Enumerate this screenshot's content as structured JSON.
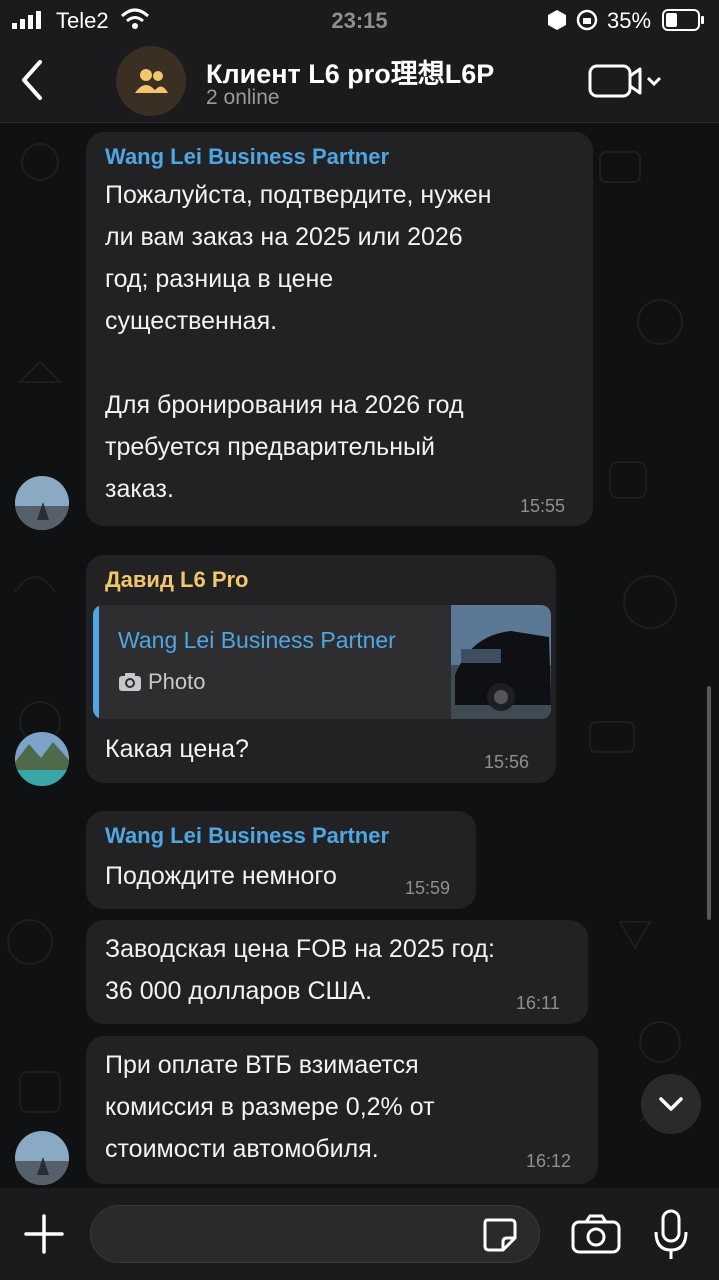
{
  "status_bar": {
    "carrier": "Tele2",
    "time": "23:15",
    "battery_percent": "35%",
    "battery_level": 0.35
  },
  "header": {
    "title": "Клиент L6 pro理想L6P",
    "subtitle": "2 online",
    "back_icon": "chevron-left-icon",
    "group_icon": "group-icon",
    "video_icon": "video-camera-icon"
  },
  "messages": [
    {
      "sender": "Wang Lei Business Partner",
      "sender_color": "#4ea6e3",
      "lines": [
        "Пожалуйста, подтвердите, нужен",
        "ли вам заказ на 2025 или 2026",
        "год; разница в цене",
        "существенная.",
        "",
        "Для бронирования на 2026 год",
        "требуется предварительный",
        "заказ."
      ],
      "time": "15:55"
    },
    {
      "sender": "Давид L6 Pro",
      "sender_color": "#f2c66d",
      "reply": {
        "name": "Wang Lei Business Partner",
        "label": "Photo"
      },
      "lines": [
        "Какая цена?"
      ],
      "time": "15:56"
    },
    {
      "sender": "Wang Lei Business Partner",
      "sender_color": "#4ea6e3",
      "lines": [
        "Подождите немного"
      ],
      "time": "15:59"
    },
    {
      "lines": [
        "Заводская цена FOB на 2025 год:",
        "36 000 долларов США."
      ],
      "time": "16:11"
    },
    {
      "lines": [
        "При оплате ВТБ взимается",
        "комиссия в размере 0,2% от",
        "стоимости автомобиля."
      ],
      "time": "16:12"
    }
  ],
  "input": {
    "placeholder": "",
    "icons": [
      "plus-icon",
      "sticker-icon",
      "camera-icon",
      "microphone-icon"
    ]
  },
  "colors": {
    "accent_blue": "#4ea6e3",
    "accent_gold": "#f2c66d",
    "bubble": "#222224",
    "bar": "#1b1b1d"
  }
}
